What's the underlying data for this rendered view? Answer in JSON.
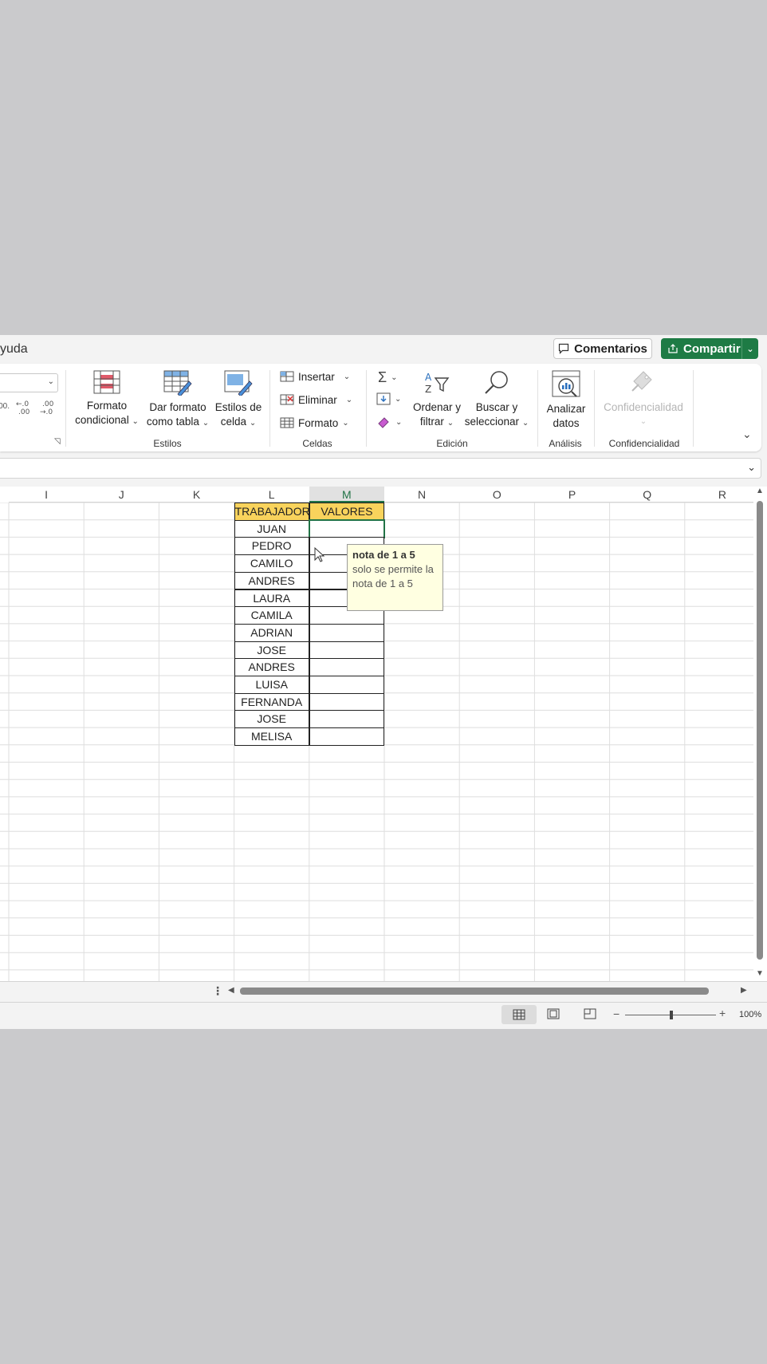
{
  "topbar": {
    "tab_ayuda": "yuda",
    "comments_label": "Comentarios",
    "share_label": "Compartir"
  },
  "ribbon": {
    "estilos": {
      "group_label": "Estilos",
      "formato_condicional": [
        "Formato",
        "condicional"
      ],
      "dar_formato_tabla": [
        "Dar formato",
        "como tabla"
      ],
      "estilos_celda": [
        "Estilos de",
        "celda"
      ]
    },
    "celdas": {
      "group_label": "Celdas",
      "insertar": "Insertar",
      "eliminar": "Eliminar",
      "formato": "Formato"
    },
    "edicion": {
      "group_label": "Edición",
      "ordenar_filtrar": [
        "Ordenar y",
        "filtrar"
      ],
      "buscar_seleccionar": [
        "Buscar y",
        "seleccionar"
      ]
    },
    "analisis": {
      "group_label": "Análisis",
      "analizar_datos": [
        "Analizar",
        "datos"
      ]
    },
    "confidencialidad": {
      "group_label": "Confidencialidad",
      "button_label": "Confidencialidad"
    },
    "numero_fragment": {
      "dec_increase": ".00 →.0",
      "dec_decrease": "←.0 .00"
    }
  },
  "sheet": {
    "columns": [
      "I",
      "J",
      "K",
      "L",
      "M",
      "N",
      "O",
      "P",
      "Q",
      "R"
    ],
    "selected_column": "M",
    "header_trabajador": "TRABAJADOR",
    "header_valores": "VALORES",
    "names": [
      "JUAN",
      "PEDRO",
      "CAMILO",
      "ANDRES",
      "LAURA",
      "CAMILA",
      "ADRIAN",
      "JOSE",
      "ANDRES",
      "LUISA",
      "FERNANDA",
      "JOSE",
      "MELISA"
    ]
  },
  "tooltip": {
    "title": "nota de 1 a 5",
    "body": "solo se permite la nota de 1 a 5"
  },
  "status": {
    "zoom": "100%"
  }
}
